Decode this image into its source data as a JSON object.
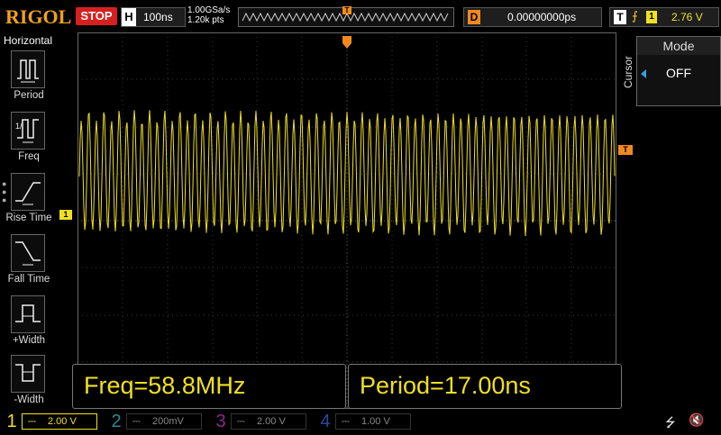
{
  "brand": "RIGOL",
  "run_state": "STOP",
  "timebase": {
    "label": "H",
    "value": "100ns"
  },
  "sampling": {
    "rate": "1.00GSa/s",
    "points": "1.20k pts"
  },
  "trigger_marker": "T",
  "delay": {
    "label": "D",
    "value": "0.00000000ps"
  },
  "trigger": {
    "label": "T",
    "edge_icon": "rising-edge-icon",
    "edge_glyph": "⨍",
    "channel": "1",
    "level": "2.76 V"
  },
  "left_menu": {
    "title": "Horizontal",
    "items": [
      {
        "label": "Period",
        "icon": "period-icon"
      },
      {
        "label": "Freq",
        "icon": "freq-icon"
      },
      {
        "label": "Rise Time",
        "icon": "rise-time-icon"
      },
      {
        "label": "Fall Time",
        "icon": "fall-time-icon"
      },
      {
        "label": "+Width",
        "icon": "pos-width-icon"
      },
      {
        "label": "-Width",
        "icon": "neg-width-icon"
      }
    ]
  },
  "ch1_marker": "1",
  "trigger_level_marker": "T",
  "right_panel": {
    "side_label": "Cursor",
    "title": "Mode",
    "value": "OFF"
  },
  "measurements": {
    "freq": "Freq=58.8MHz",
    "period": "Period=17.00ns"
  },
  "channels": [
    {
      "num": "1",
      "coupling": "⎓",
      "value": "2.00 V",
      "color": "#f0e020",
      "active": true
    },
    {
      "num": "2",
      "coupling": "⎓",
      "value": "200mV",
      "color": "#20c8d8",
      "active": false
    },
    {
      "num": "3",
      "coupling": "⎓",
      "value": "2.00 V",
      "color": "#d030d0",
      "active": false
    },
    {
      "num": "4",
      "coupling": "⎓",
      "value": "1.00 V",
      "color": "#3070f0",
      "active": false
    }
  ],
  "status_icons": {
    "usb": "usb-icon",
    "usb_glyph": "⭍",
    "sound": "speaker-mute-icon",
    "sound_glyph": "🔇"
  },
  "colors": {
    "ch1": "#f0e020",
    "trigger": "#f08a1e",
    "stop": "#d62020",
    "brand": "#f0a020"
  }
}
